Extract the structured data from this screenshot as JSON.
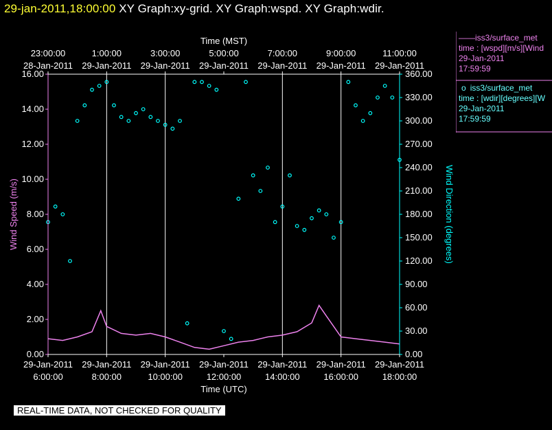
{
  "header": {
    "datetime": "29-jan-2011,18:00:00",
    "graphs": "XY Graph:xy-grid.  XY Graph:wspd.  XY Graph:wdir."
  },
  "legend": {
    "wspd": {
      "symbol": "——",
      "title": "iss3/surface_met",
      "line1": "time : [wspd][m/s][Wind",
      "line2": "29-Jan-2011",
      "line3": "17:59:59"
    },
    "wdir": {
      "symbol": "o",
      "title": "iss3/surface_met",
      "line1": "time : [wdir][degrees][W",
      "line2": "29-Jan-2011",
      "line3": "17:59:59"
    }
  },
  "footer": {
    "quality_note": "REAL-TIME DATA, NOT CHECKED FOR QUALITY"
  },
  "chart_data": {
    "type": "line",
    "colors": {
      "wspd": "#ee82ee",
      "wdir": "#00ffff",
      "axis": "#ee82ee",
      "wdir_axis": "#00ffff",
      "grid": "#ffffff",
      "text": "#ffffff"
    },
    "top_axis": {
      "label": "Time (MST)",
      "ticks": [
        {
          "time": "23:00:00",
          "date": "28-Jan-2011"
        },
        {
          "time": "1:00:00",
          "date": "29-Jan-2011"
        },
        {
          "time": "3:00:00",
          "date": "29-Jan-2011"
        },
        {
          "time": "5:00:00",
          "date": "29-Jan-2011"
        },
        {
          "time": "7:00:00",
          "date": "29-Jan-2011"
        },
        {
          "time": "9:00:00",
          "date": "29-Jan-2011"
        },
        {
          "time": "11:00:00",
          "date": "29-Jan-2011"
        }
      ]
    },
    "bottom_axis": {
      "label": "Time (UTC)",
      "ticks": [
        {
          "date": "29-Jan-2011",
          "time": "6:00:00"
        },
        {
          "date": "29-Jan-2011",
          "time": "8:00:00"
        },
        {
          "date": "29-Jan-2011",
          "time": "10:00:00"
        },
        {
          "date": "29-Jan-2011",
          "time": "12:00:00"
        },
        {
          "date": "29-Jan-2011",
          "time": "14:00:00"
        },
        {
          "date": "29-Jan-2011",
          "time": "16:00:00"
        },
        {
          "date": "29-Jan-2011",
          "time": "18:00:00"
        }
      ],
      "range_utc_hours": [
        6,
        18
      ]
    },
    "left_axis": {
      "label": "Wind Speed (m/s)",
      "ylim": [
        0,
        16
      ],
      "ticks": [
        "0.00",
        "2.00",
        "4.00",
        "6.00",
        "8.00",
        "10.00",
        "12.00",
        "14.00",
        "16.00"
      ]
    },
    "right_axis": {
      "label": "Wind Direction (degrees)",
      "ylim": [
        0,
        360
      ],
      "ticks": [
        "0.00",
        "30.00",
        "60.00",
        "90.00",
        "120.00",
        "150.00",
        "180.00",
        "210.00",
        "240.00",
        "270.00",
        "300.00",
        "330.00",
        "360.00"
      ]
    },
    "vertical_grid_utc_hours": [
      8,
      10,
      14,
      16
    ],
    "series": [
      {
        "key": "wspd",
        "name": "iss3/surface_met",
        "style": "line",
        "x_utc_hours": [
          6.0,
          6.5,
          7.0,
          7.5,
          7.8,
          8.0,
          8.5,
          9.0,
          9.5,
          10.0,
          10.5,
          11.0,
          11.5,
          12.0,
          12.5,
          13.0,
          13.5,
          14.0,
          14.5,
          15.0,
          15.25,
          15.5,
          15.75,
          16.0,
          16.5,
          17.0,
          17.5,
          18.0
        ],
        "values": [
          0.9,
          0.8,
          1.0,
          1.3,
          2.5,
          1.6,
          1.2,
          1.1,
          1.2,
          1.0,
          0.7,
          0.4,
          0.3,
          0.5,
          0.7,
          0.8,
          1.0,
          1.1,
          1.3,
          1.8,
          2.8,
          2.2,
          1.6,
          1.0,
          0.9,
          0.8,
          0.7,
          0.6
        ]
      },
      {
        "key": "wdir",
        "name": "iss3/surface_met",
        "style": "markers",
        "x_utc_hours": [
          6.0,
          6.25,
          6.5,
          6.75,
          7.0,
          7.25,
          7.5,
          7.75,
          8.0,
          8.25,
          8.5,
          8.75,
          9.0,
          9.25,
          9.5,
          9.75,
          10.0,
          10.25,
          10.5,
          10.75,
          11.0,
          11.25,
          11.5,
          11.75,
          12.0,
          12.25,
          12.5,
          12.75,
          13.0,
          13.25,
          13.5,
          13.75,
          14.0,
          14.25,
          14.5,
          14.75,
          15.0,
          15.25,
          15.5,
          15.75,
          16.0,
          16.25,
          16.5,
          16.75,
          17.0,
          17.25,
          17.5,
          17.75,
          18.0
        ],
        "values": [
          170,
          190,
          180,
          120,
          300,
          320,
          340,
          345,
          350,
          320,
          305,
          300,
          310,
          315,
          305,
          300,
          295,
          290,
          300,
          40,
          350,
          350,
          345,
          340,
          30,
          20,
          200,
          350,
          230,
          210,
          240,
          170,
          190,
          230,
          165,
          160,
          175,
          185,
          180,
          150,
          170,
          350,
          320,
          300,
          310,
          330,
          345,
          330,
          250
        ]
      }
    ]
  }
}
